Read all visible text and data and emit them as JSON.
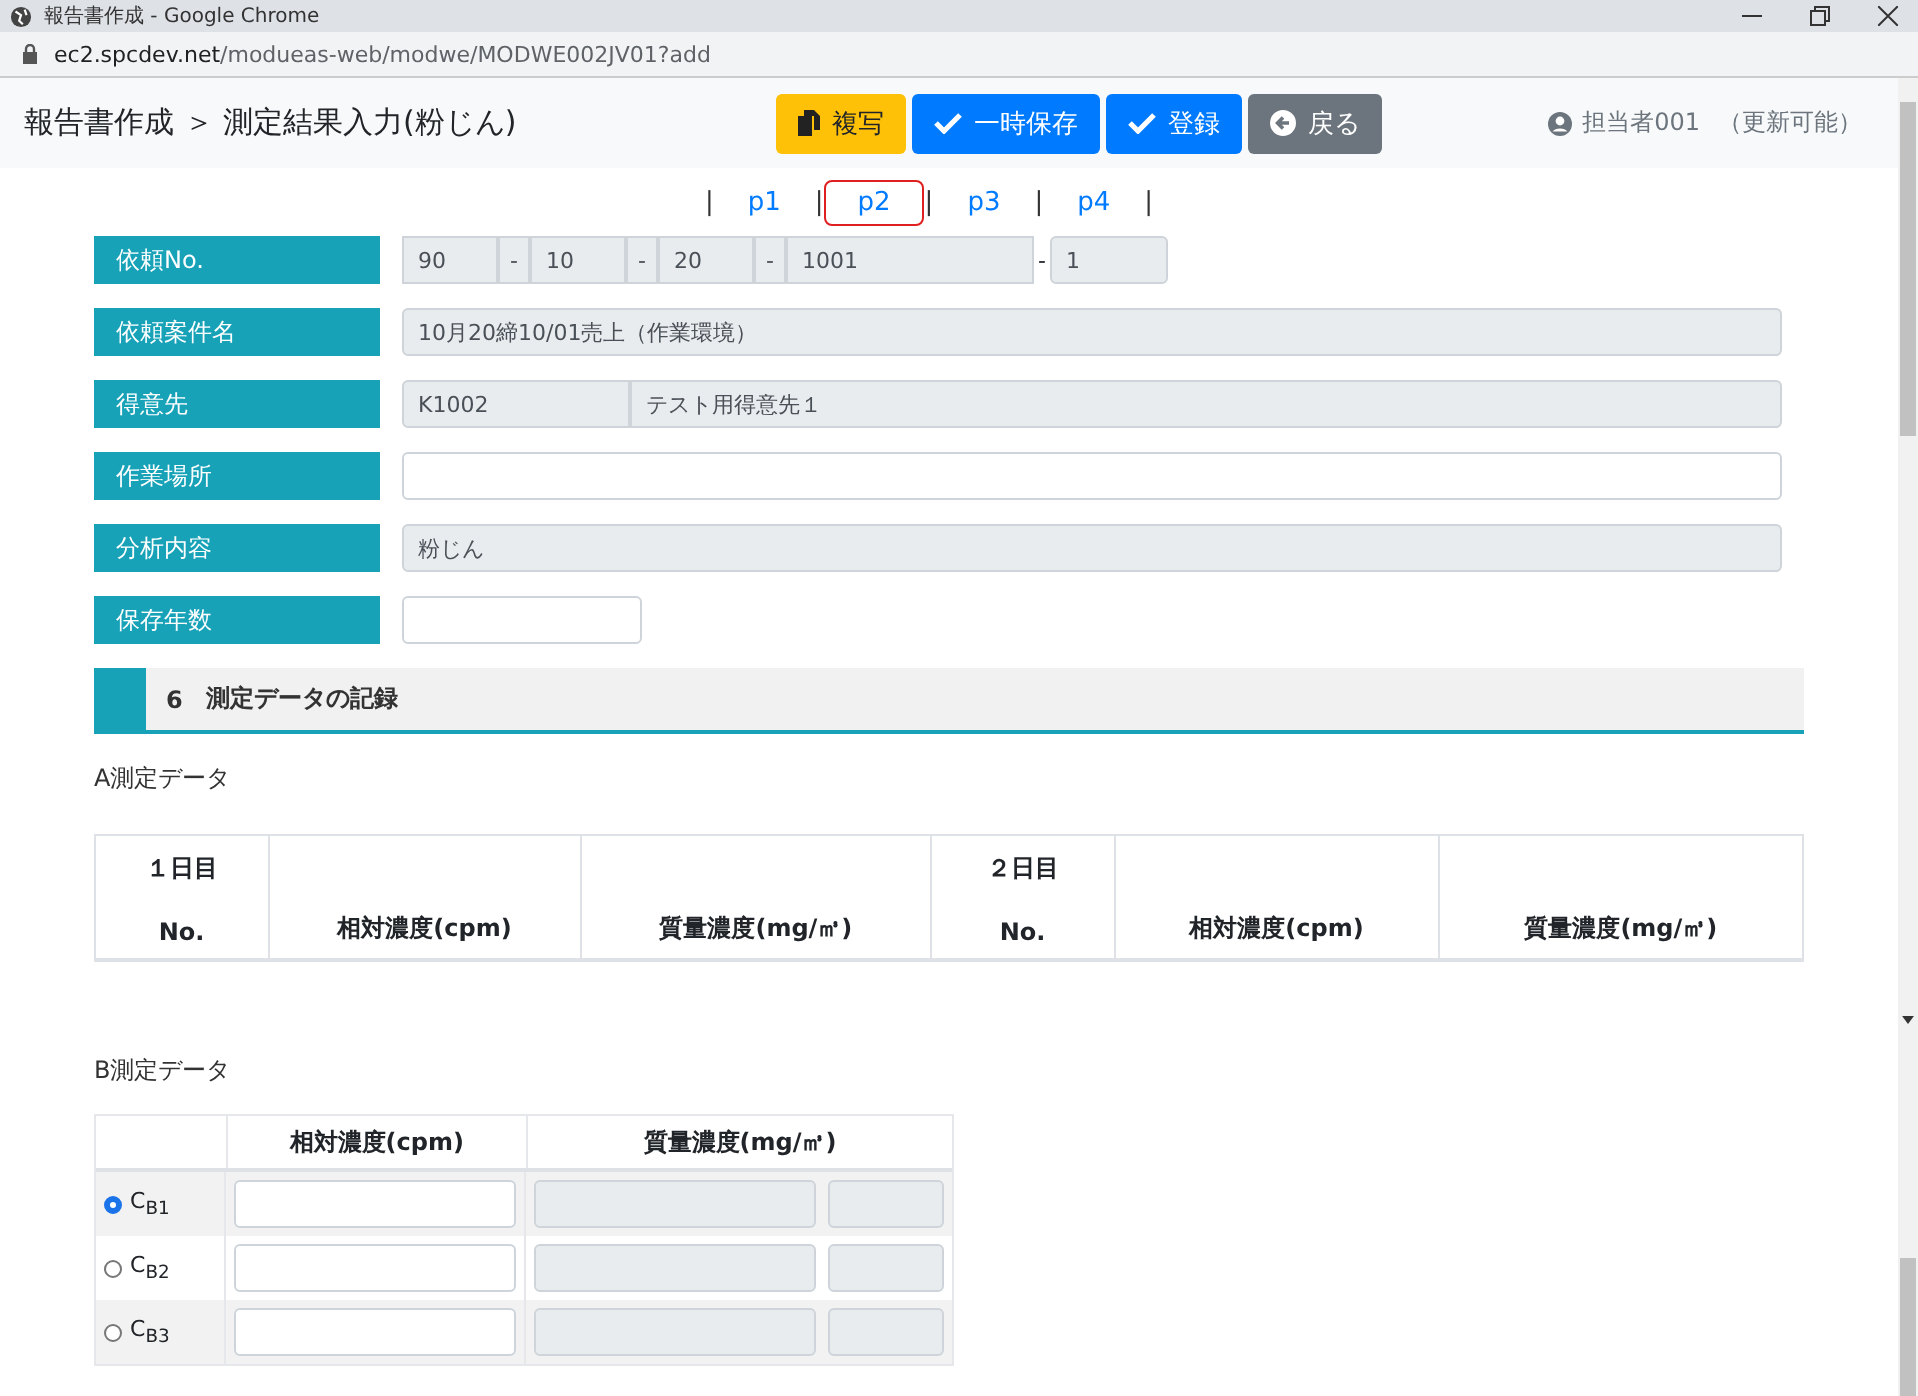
{
  "window": {
    "title": "報告書作成 - Google Chrome"
  },
  "address_bar": {
    "host": "ec2.spcdev.net",
    "path": "/modueas-web/modwe/MODWE002JV01?add"
  },
  "header": {
    "breadcrumb": "報告書作成 ＞ 測定結果入力(粉じん)",
    "buttons": [
      {
        "kind": "copy",
        "label": "複写"
      },
      {
        "kind": "save",
        "label": "一時保存"
      },
      {
        "kind": "register",
        "label": "登録"
      },
      {
        "kind": "back",
        "label": "戻る"
      }
    ],
    "user": "担当者001",
    "status": "（更新可能）"
  },
  "pages": [
    {
      "kind": "separator",
      "text": "|"
    },
    {
      "kind": "page",
      "label": "p1",
      "selected": false
    },
    {
      "kind": "separator",
      "text": "|"
    },
    {
      "kind": "page",
      "label": "p2",
      "selected": true
    },
    {
      "kind": "separator",
      "text": "|"
    },
    {
      "kind": "page",
      "label": "p3",
      "selected": false
    },
    {
      "kind": "separator",
      "text": "|"
    },
    {
      "kind": "page",
      "label": "p4",
      "selected": false
    },
    {
      "kind": "separator",
      "text": "|"
    }
  ],
  "form": [
    {
      "label": "依頼No.",
      "kind": "request_no",
      "parts": [
        {
          "kind": "field",
          "value": "90"
        },
        {
          "kind": "addon",
          "value": "-"
        },
        {
          "kind": "field",
          "value": "10"
        },
        {
          "kind": "addon",
          "value": "-"
        },
        {
          "kind": "field",
          "value": "20"
        },
        {
          "kind": "addon",
          "value": "-"
        },
        {
          "kind": "field",
          "value": "1001"
        },
        {
          "kind": "dash",
          "value": "-"
        },
        {
          "kind": "field",
          "value": "1"
        }
      ]
    },
    {
      "label": "依頼案件名",
      "kind": "text",
      "readonly": true,
      "value": "10月20締10/01売上（作業環境）"
    },
    {
      "label": "得意先",
      "kind": "customer",
      "readonly": true,
      "code": "K1002",
      "name": "テスト用得意先１"
    },
    {
      "label": "作業場所",
      "kind": "text",
      "readonly": false
    },
    {
      "label": "分析内容",
      "kind": "text",
      "readonly": true,
      "value": "粉じん"
    },
    {
      "label": "保存年数",
      "kind": "short",
      "readonly": false
    }
  ],
  "section": {
    "number": "6",
    "title": "測定データの記録"
  },
  "table_a": {
    "title": "A測定データ",
    "groups": [
      {
        "day": "１日目",
        "columns": [
          "No.",
          "相対濃度(cpm)",
          "質量濃度(mg/㎥)"
        ]
      },
      {
        "day": "２日目",
        "columns": [
          "No.",
          "相対濃度(cpm)",
          "質量濃度(mg/㎥)"
        ]
      }
    ]
  },
  "table_b": {
    "title": "B測定データ",
    "columns": [
      "相対濃度(cpm)",
      "質量濃度(mg/㎥)"
    ],
    "rows": [
      {
        "label": "C$_{B1}$",
        "selected": true
      },
      {
        "label": "C$_{B2}$",
        "selected": false
      },
      {
        "label": "C$_{B3}$",
        "selected": false
      }
    ]
  }
}
